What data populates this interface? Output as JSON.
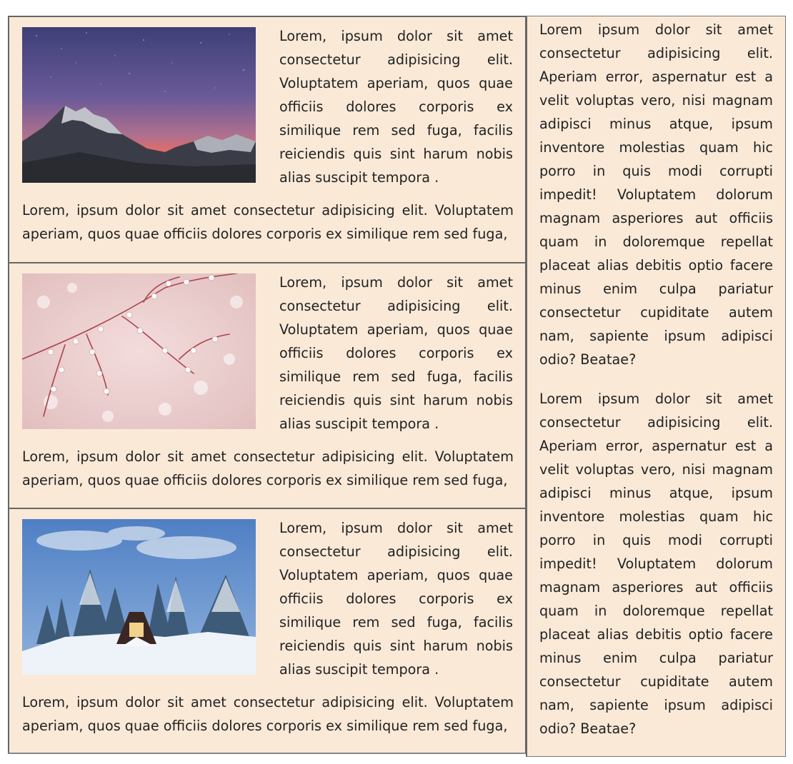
{
  "cards": [
    {
      "image_alt": "mountain-night-sky",
      "side_text": "Lorem, ipsum dolor sit amet consectetur adipisicing elit. Voluptatem aperiam, quos quae officiis dolores corporis ex similique rem sed fuga, facilis reiciendis quis sint harum nobis alias suscipit tempora .",
      "full_text": "Lorem, ipsum dolor sit amet consectetur adipisicing elit. Voluptatem aperiam, quos quae officiis dolores corporis ex similique rem sed fuga,"
    },
    {
      "image_alt": "blossom-branches",
      "side_text": "Lorem, ipsum dolor sit amet consectetur adipisicing elit. Voluptatem aperiam, quos quae officiis dolores corporis ex similique rem sed fuga, facilis reiciendis quis sint harum nobis alias suscipit tempora .",
      "full_text": "Lorem, ipsum dolor sit amet consectetur adipisicing elit. Voluptatem aperiam, quos quae officiis dolores corporis ex similique rem sed fuga,"
    },
    {
      "image_alt": "snowy-cabin",
      "side_text": "Lorem, ipsum dolor sit amet consectetur adipisicing elit. Voluptatem aperiam, quos quae officiis dolores corporis ex similique rem sed fuga, facilis reiciendis quis sint harum nobis alias suscipit tempora .",
      "full_text": "Lorem, ipsum dolor sit amet consectetur adipisicing elit. Voluptatem aperiam, quos quae officiis dolores corporis ex similique rem sed fuga,"
    }
  ],
  "sidebar": {
    "paragraphs": [
      "Lorem ipsum dolor sit amet consectetur adipisicing elit. Aperiam error, aspernatur est a velit voluptas vero, nisi magnam adipisci minus atque, ipsum inventore molestias quam hic porro in quis modi corrupti impedit! Voluptatem dolorum magnam asperiores aut officiis quam in doloremque repellat placeat alias debitis optio facere minus enim culpa pariatur consectetur cupiditate autem nam, sapiente ipsum adipisci odio? Beatae?",
      "Lorem ipsum dolor sit amet consectetur adipisicing elit. Aperiam error, aspernatur est a velit voluptas vero, nisi magnam adipisci minus atque, ipsum inventore molestias quam hic porro in quis modi corrupti impedit! Voluptatem dolorum magnam asperiores aut officiis quam in doloremque repellat placeat alias debitis optio facere minus enim culpa pariatur consectetur cupiditate autem nam, sapiente ipsum adipisci odio? Beatae?"
    ]
  },
  "colors": {
    "card_background": "#fae9d7",
    "border": "#666666",
    "text": "#222222"
  }
}
